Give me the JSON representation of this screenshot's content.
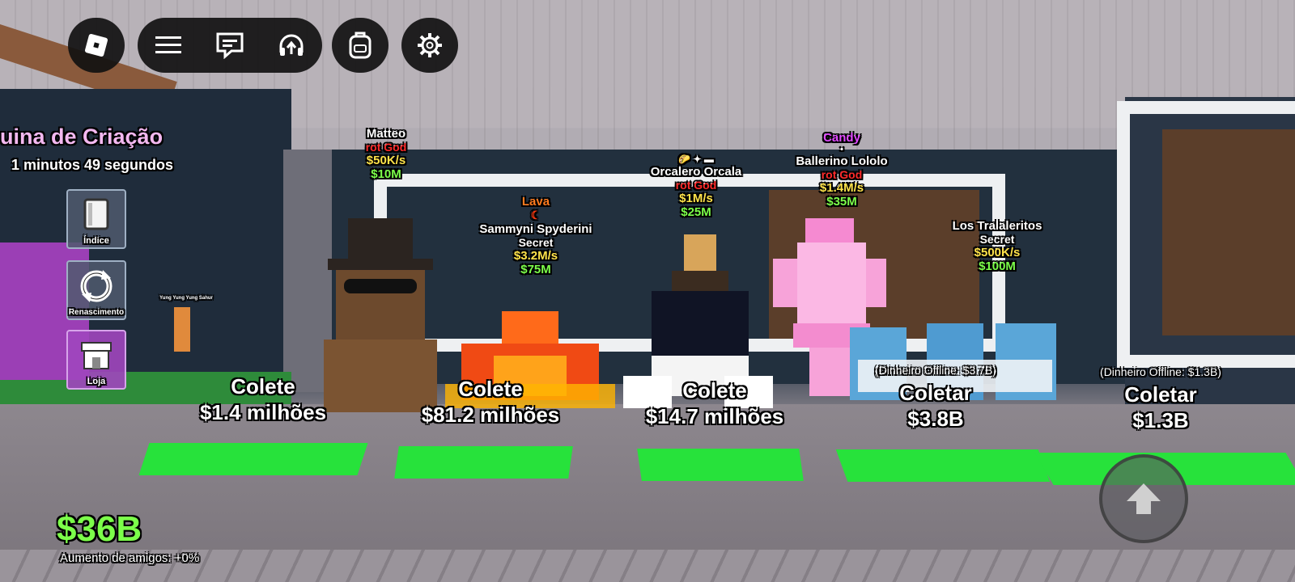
{
  "top_bar": {
    "buttons": [
      {
        "name": "roblox-logo-icon"
      },
      {
        "name": "menu-icon"
      },
      {
        "name": "chat-icon"
      },
      {
        "name": "voice-headset-icon"
      },
      {
        "name": "backpack-icon"
      },
      {
        "name": "settings-gear-icon"
      }
    ]
  },
  "event_banner": {
    "title": "uina de Criação",
    "timer": "1 minutos 49 segundos"
  },
  "side_menu": {
    "index_label": "Índice",
    "rebirth_label": "Renascimento",
    "shop_label": "Loja"
  },
  "characters": [
    {
      "name": "Matteo",
      "rarity": "Brainrot God",
      "rarity_visible": "rot God",
      "rate": "$50K/s",
      "price": "$10M"
    },
    {
      "trait": "Lava",
      "name": "Sammyni Spyderini",
      "rarity": "Secret",
      "rate": "$3.2M/s",
      "price": "$75M"
    },
    {
      "name": "Orcalero Orcala",
      "rarity_visible": "rot God",
      "rate": "$1M/s",
      "price": "$25M"
    },
    {
      "trait": "Candy",
      "name": "Ballerino Lololo",
      "rarity_visible": "rot God",
      "rate": "$1.4M/s",
      "price": "$35M"
    },
    {
      "name": "Los Tralaleritos",
      "rarity": "Secret",
      "rate": "$500K/s",
      "price": "$100M"
    }
  ],
  "collect_buttons": [
    {
      "action": "Colete",
      "amount": "$1.4 milhões"
    },
    {
      "action": "Colete",
      "amount": "$81.2 milhões"
    },
    {
      "action": "Colete",
      "amount": "$14.7 milhões"
    },
    {
      "offline": "(Dinheiro Offline: $3.7B)",
      "action": "Coletar",
      "amount": "$3.8B"
    },
    {
      "offline": "(Dinheiro Offline: $1.3B)",
      "action": "Coletar",
      "amount": "$1.3B"
    }
  ],
  "npc_tag": "Yung Yung Yung Sahur",
  "balance": "$36B",
  "friend_boost": "Aumento de amigos: +0%",
  "colors": {
    "money_green": "#7cff4a",
    "rate_yellow": "#ffe34a",
    "god_red": "#ff2a2a",
    "lava_orange": "#ff7b1f",
    "candy_pink": "#e24bff",
    "banner_pink": "#f3b8f0"
  }
}
